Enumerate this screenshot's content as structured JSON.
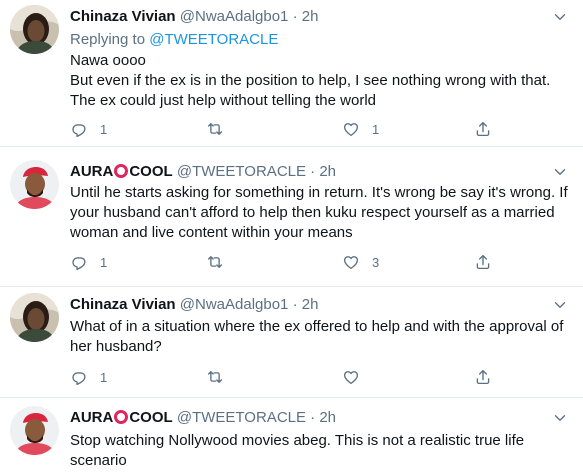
{
  "tweets": [
    {
      "name": "Chinaza Vivian",
      "handle": "@NwaAdalgbo1",
      "time": "2h",
      "replying_prefix": "Replying to ",
      "replying_to": "@TWEETORACLE",
      "lines": [
        "Nawa oooo",
        "But even if the ex is in the position to help, I see nothing wrong with that.",
        "The ex could just help without telling the world"
      ],
      "reply_count": "1",
      "retweet_count": "",
      "like_count": "1"
    },
    {
      "name_pre": "AURA",
      "name_post": "COOL",
      "handle": "@TWEETORACLE",
      "time": "2h",
      "lines": [
        "Until he starts asking for something in return. It's wrong be say it's wrong. If",
        "your husband can't afford to help then kuku respect yourself as a married",
        "woman and live content within your means"
      ],
      "reply_count": "1",
      "retweet_count": "",
      "like_count": "3"
    },
    {
      "name": "Chinaza Vivian",
      "handle": "@NwaAdalgbo1",
      "time": "2h",
      "lines": [
        "What of in a situation where the ex offered to help and with the approval of",
        "her husband?"
      ],
      "reply_count": "1",
      "retweet_count": "",
      "like_count": ""
    },
    {
      "name_pre": "AURA",
      "name_post": "COOL",
      "handle": "@TWEETORACLE",
      "time": "2h",
      "lines": [
        "Stop watching Nollywood movies abeg. This is not a realistic true life",
        "scenario"
      ]
    }
  ],
  "separator": "·",
  "colors": {
    "link": "#1b95e0",
    "muted": "#5b7083",
    "ring": "#e0245e"
  },
  "icons": [
    "reply-icon",
    "retweet-icon",
    "like-icon",
    "share-icon",
    "more-caret-icon"
  ]
}
